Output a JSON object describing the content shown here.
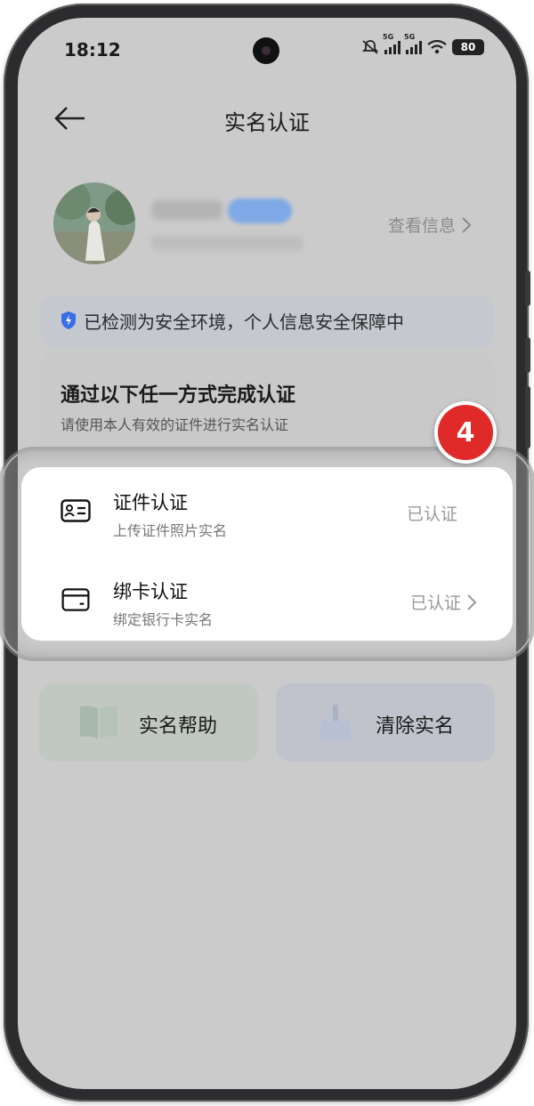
{
  "status_bar": {
    "time": "18:12",
    "network_1": "5G",
    "network_2": "5G",
    "battery": "80",
    "icons": [
      "mute-icon",
      "signal-icon",
      "signal-icon",
      "wifi-icon",
      "battery-icon"
    ]
  },
  "header": {
    "title": "实名认证",
    "back_icon": "arrow-left-icon"
  },
  "profile": {
    "view_info_label": "查看信息"
  },
  "safe_banner": {
    "text": "已检测为安全环境，个人信息安全保障中",
    "icon": "shield-icon",
    "accent": "#3a6ee8"
  },
  "verify_card": {
    "title": "通过以下任一方式完成认证",
    "subtitle": "请使用本人有效的证件进行实名认证"
  },
  "methods": [
    {
      "title": "证件认证",
      "subtitle": "上传证件照片实名",
      "status": "已认证",
      "icon": "id-card-icon"
    },
    {
      "title": "绑卡认证",
      "subtitle": "绑定银行卡实名",
      "status": "已认证",
      "icon": "bank-card-icon"
    }
  ],
  "bottom_buttons": {
    "help_label": "实名帮助",
    "clear_label": "清除实名"
  },
  "annotation": {
    "step_number": "4",
    "color": "#e02a2a"
  }
}
